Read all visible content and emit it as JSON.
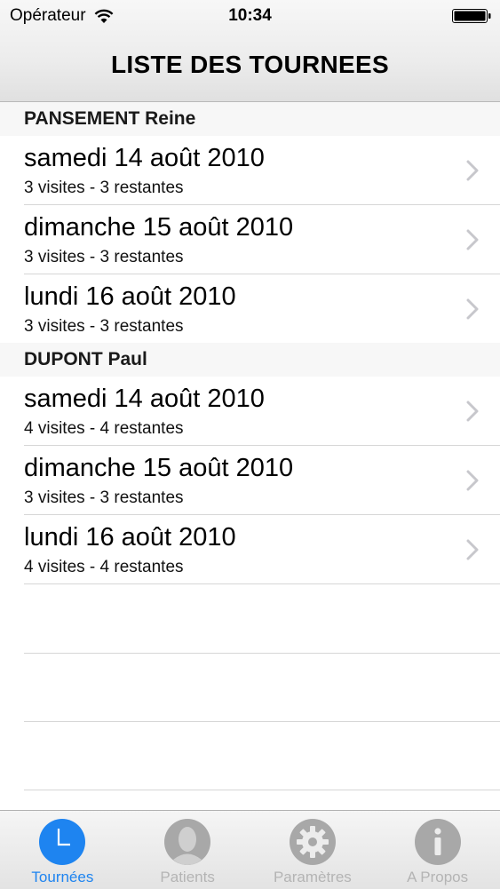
{
  "status_bar": {
    "carrier": "Opérateur",
    "time": "10:34"
  },
  "nav": {
    "title": "LISTE DES TOURNEES"
  },
  "sections": [
    {
      "header": "PANSEMENT Reine",
      "rows": [
        {
          "date": "samedi 14 août 2010",
          "detail": "3 visites - 3 restantes"
        },
        {
          "date": "dimanche 15 août 2010",
          "detail": "3 visites - 3 restantes"
        },
        {
          "date": "lundi 16 août 2010",
          "detail": "3 visites - 3 restantes"
        }
      ]
    },
    {
      "header": "DUPONT Paul",
      "rows": [
        {
          "date": "samedi 14 août 2010",
          "detail": "4 visites - 4 restantes"
        },
        {
          "date": "dimanche 15 août 2010",
          "detail": "3 visites - 3 restantes"
        },
        {
          "date": "lundi 16 août 2010",
          "detail": "4 visites - 4 restantes"
        }
      ]
    }
  ],
  "tabbar": {
    "tabs": [
      {
        "label": "Tournées",
        "icon": "clock-icon",
        "active": true
      },
      {
        "label": "Patients",
        "icon": "person-icon",
        "active": false
      },
      {
        "label": "Paramètres",
        "icon": "gear-icon",
        "active": false
      },
      {
        "label": "A Propos",
        "icon": "info-icon",
        "active": false
      }
    ]
  },
  "colors": {
    "accent": "#1e84f0",
    "inactive_tab": "#b4b4b4",
    "section_bg": "#f7f7f7"
  }
}
